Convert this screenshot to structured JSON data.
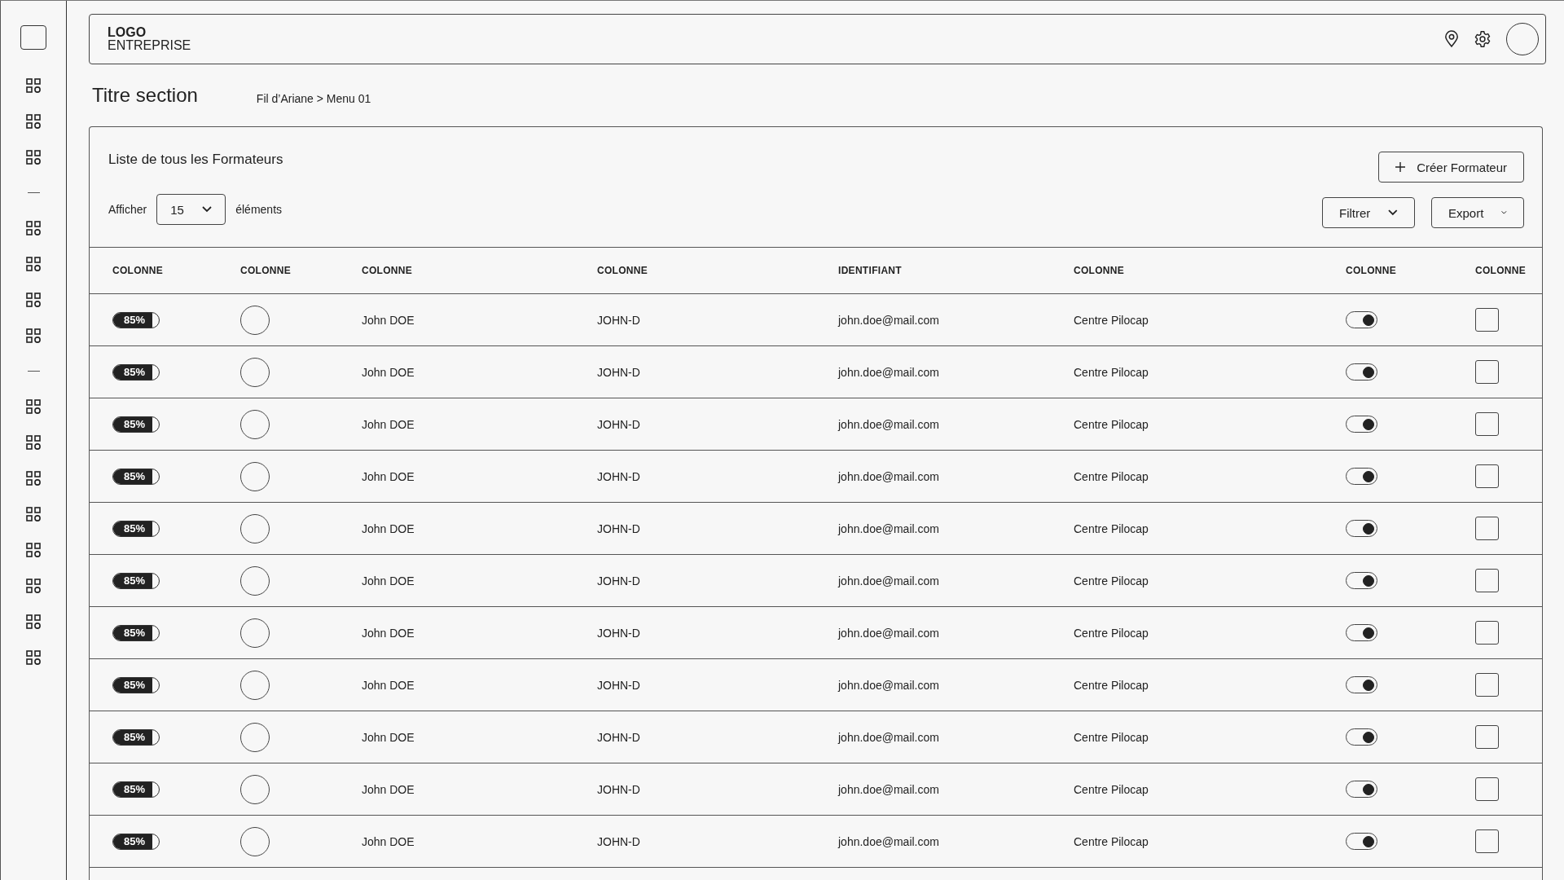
{
  "sidebar": {
    "items": [
      {
        "kind": "logo"
      },
      {
        "kind": "icon"
      },
      {
        "kind": "icon"
      },
      {
        "kind": "icon"
      },
      {
        "kind": "divider"
      },
      {
        "kind": "icon"
      },
      {
        "kind": "icon"
      },
      {
        "kind": "icon"
      },
      {
        "kind": "icon"
      },
      {
        "kind": "divider"
      },
      {
        "kind": "icon"
      },
      {
        "kind": "icon"
      },
      {
        "kind": "icon"
      },
      {
        "kind": "icon"
      },
      {
        "kind": "icon"
      },
      {
        "kind": "icon"
      },
      {
        "kind": "icon"
      },
      {
        "kind": "icon"
      }
    ]
  },
  "header": {
    "logo_line1": "LOGO",
    "logo_line2": "ENTREPRISE"
  },
  "page_title": "Titre section",
  "breadcrumb": "Fil d’Ariane > Menu 01",
  "card": {
    "title": "Liste de tous les Formateurs",
    "create_button": "Créer Formateur",
    "show_label": "Afficher",
    "page_size": "15",
    "show_suffix": "éléments",
    "filter_button": "Filtrer",
    "export_button": "Export"
  },
  "table": {
    "columns": [
      "COLONNE",
      "COLONNE",
      "COLONNE",
      "COLONNE",
      "IDENTIFIANT",
      "COLONNE",
      "COLONNE",
      "COLONNE"
    ],
    "rows": [
      {
        "progress": "85%",
        "level": 0.85,
        "name": "John DOE",
        "code": "JOHN-D",
        "email": "john.doe@mail.com",
        "centre": "Centre Pilocap",
        "on": true,
        "checked": false
      },
      {
        "progress": "85%",
        "level": 0.85,
        "name": "John DOE",
        "code": "JOHN-D",
        "email": "john.doe@mail.com",
        "centre": "Centre Pilocap",
        "on": true,
        "checked": false
      },
      {
        "progress": "85%",
        "level": 0.85,
        "name": "John DOE",
        "code": "JOHN-D",
        "email": "john.doe@mail.com",
        "centre": "Centre Pilocap",
        "on": true,
        "checked": false
      },
      {
        "progress": "85%",
        "level": 0.85,
        "name": "John DOE",
        "code": "JOHN-D",
        "email": "john.doe@mail.com",
        "centre": "Centre Pilocap",
        "on": true,
        "checked": false
      },
      {
        "progress": "85%",
        "level": 0.85,
        "name": "John DOE",
        "code": "JOHN-D",
        "email": "john.doe@mail.com",
        "centre": "Centre Pilocap",
        "on": true,
        "checked": false
      },
      {
        "progress": "85%",
        "level": 0.85,
        "name": "John DOE",
        "code": "JOHN-D",
        "email": "john.doe@mail.com",
        "centre": "Centre Pilocap",
        "on": true,
        "checked": false
      },
      {
        "progress": "85%",
        "level": 0.85,
        "name": "John DOE",
        "code": "JOHN-D",
        "email": "john.doe@mail.com",
        "centre": "Centre Pilocap",
        "on": true,
        "checked": false
      },
      {
        "progress": "85%",
        "level": 0.85,
        "name": "John DOE",
        "code": "JOHN-D",
        "email": "john.doe@mail.com",
        "centre": "Centre Pilocap",
        "on": true,
        "checked": false
      },
      {
        "progress": "85%",
        "level": 0.85,
        "name": "John DOE",
        "code": "JOHN-D",
        "email": "john.doe@mail.com",
        "centre": "Centre Pilocap",
        "on": true,
        "checked": false
      },
      {
        "progress": "85%",
        "level": 0.85,
        "name": "John DOE",
        "code": "JOHN-D",
        "email": "john.doe@mail.com",
        "centre": "Centre Pilocap",
        "on": true,
        "checked": false
      },
      {
        "progress": "85%",
        "level": 0.85,
        "name": "John DOE",
        "code": "JOHN-D",
        "email": "john.doe@mail.com",
        "centre": "Centre Pilocap",
        "on": true,
        "checked": false
      }
    ]
  }
}
